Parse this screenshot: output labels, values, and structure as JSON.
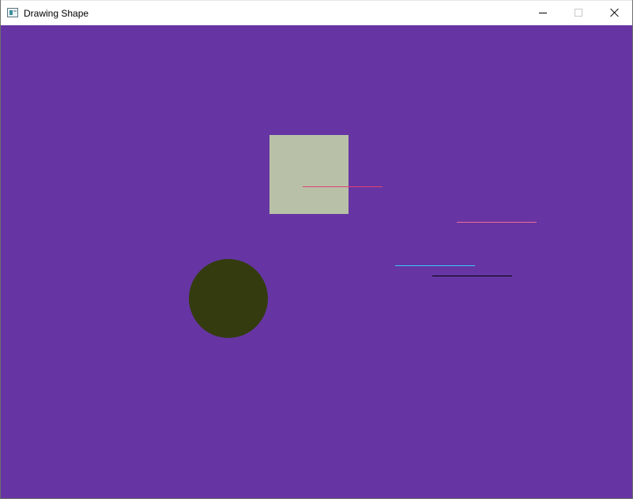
{
  "window": {
    "title": "Drawing Shape"
  },
  "canvas": {
    "background_color": "#6635a3",
    "shapes": [
      {
        "name": "square",
        "color": "#b8c1a7"
      },
      {
        "name": "circle",
        "color": "#343c0f"
      },
      {
        "name": "line-red-on-square",
        "color": "#e04070"
      },
      {
        "name": "line-pink",
        "color": "#f36a95"
      },
      {
        "name": "line-cyan",
        "color": "#37c8ff"
      },
      {
        "name": "line-black",
        "color": "#000000"
      }
    ]
  },
  "icons": {
    "app": "app-window-icon",
    "minimize": "minimize-icon",
    "maximize": "maximize-icon",
    "close": "close-icon"
  }
}
